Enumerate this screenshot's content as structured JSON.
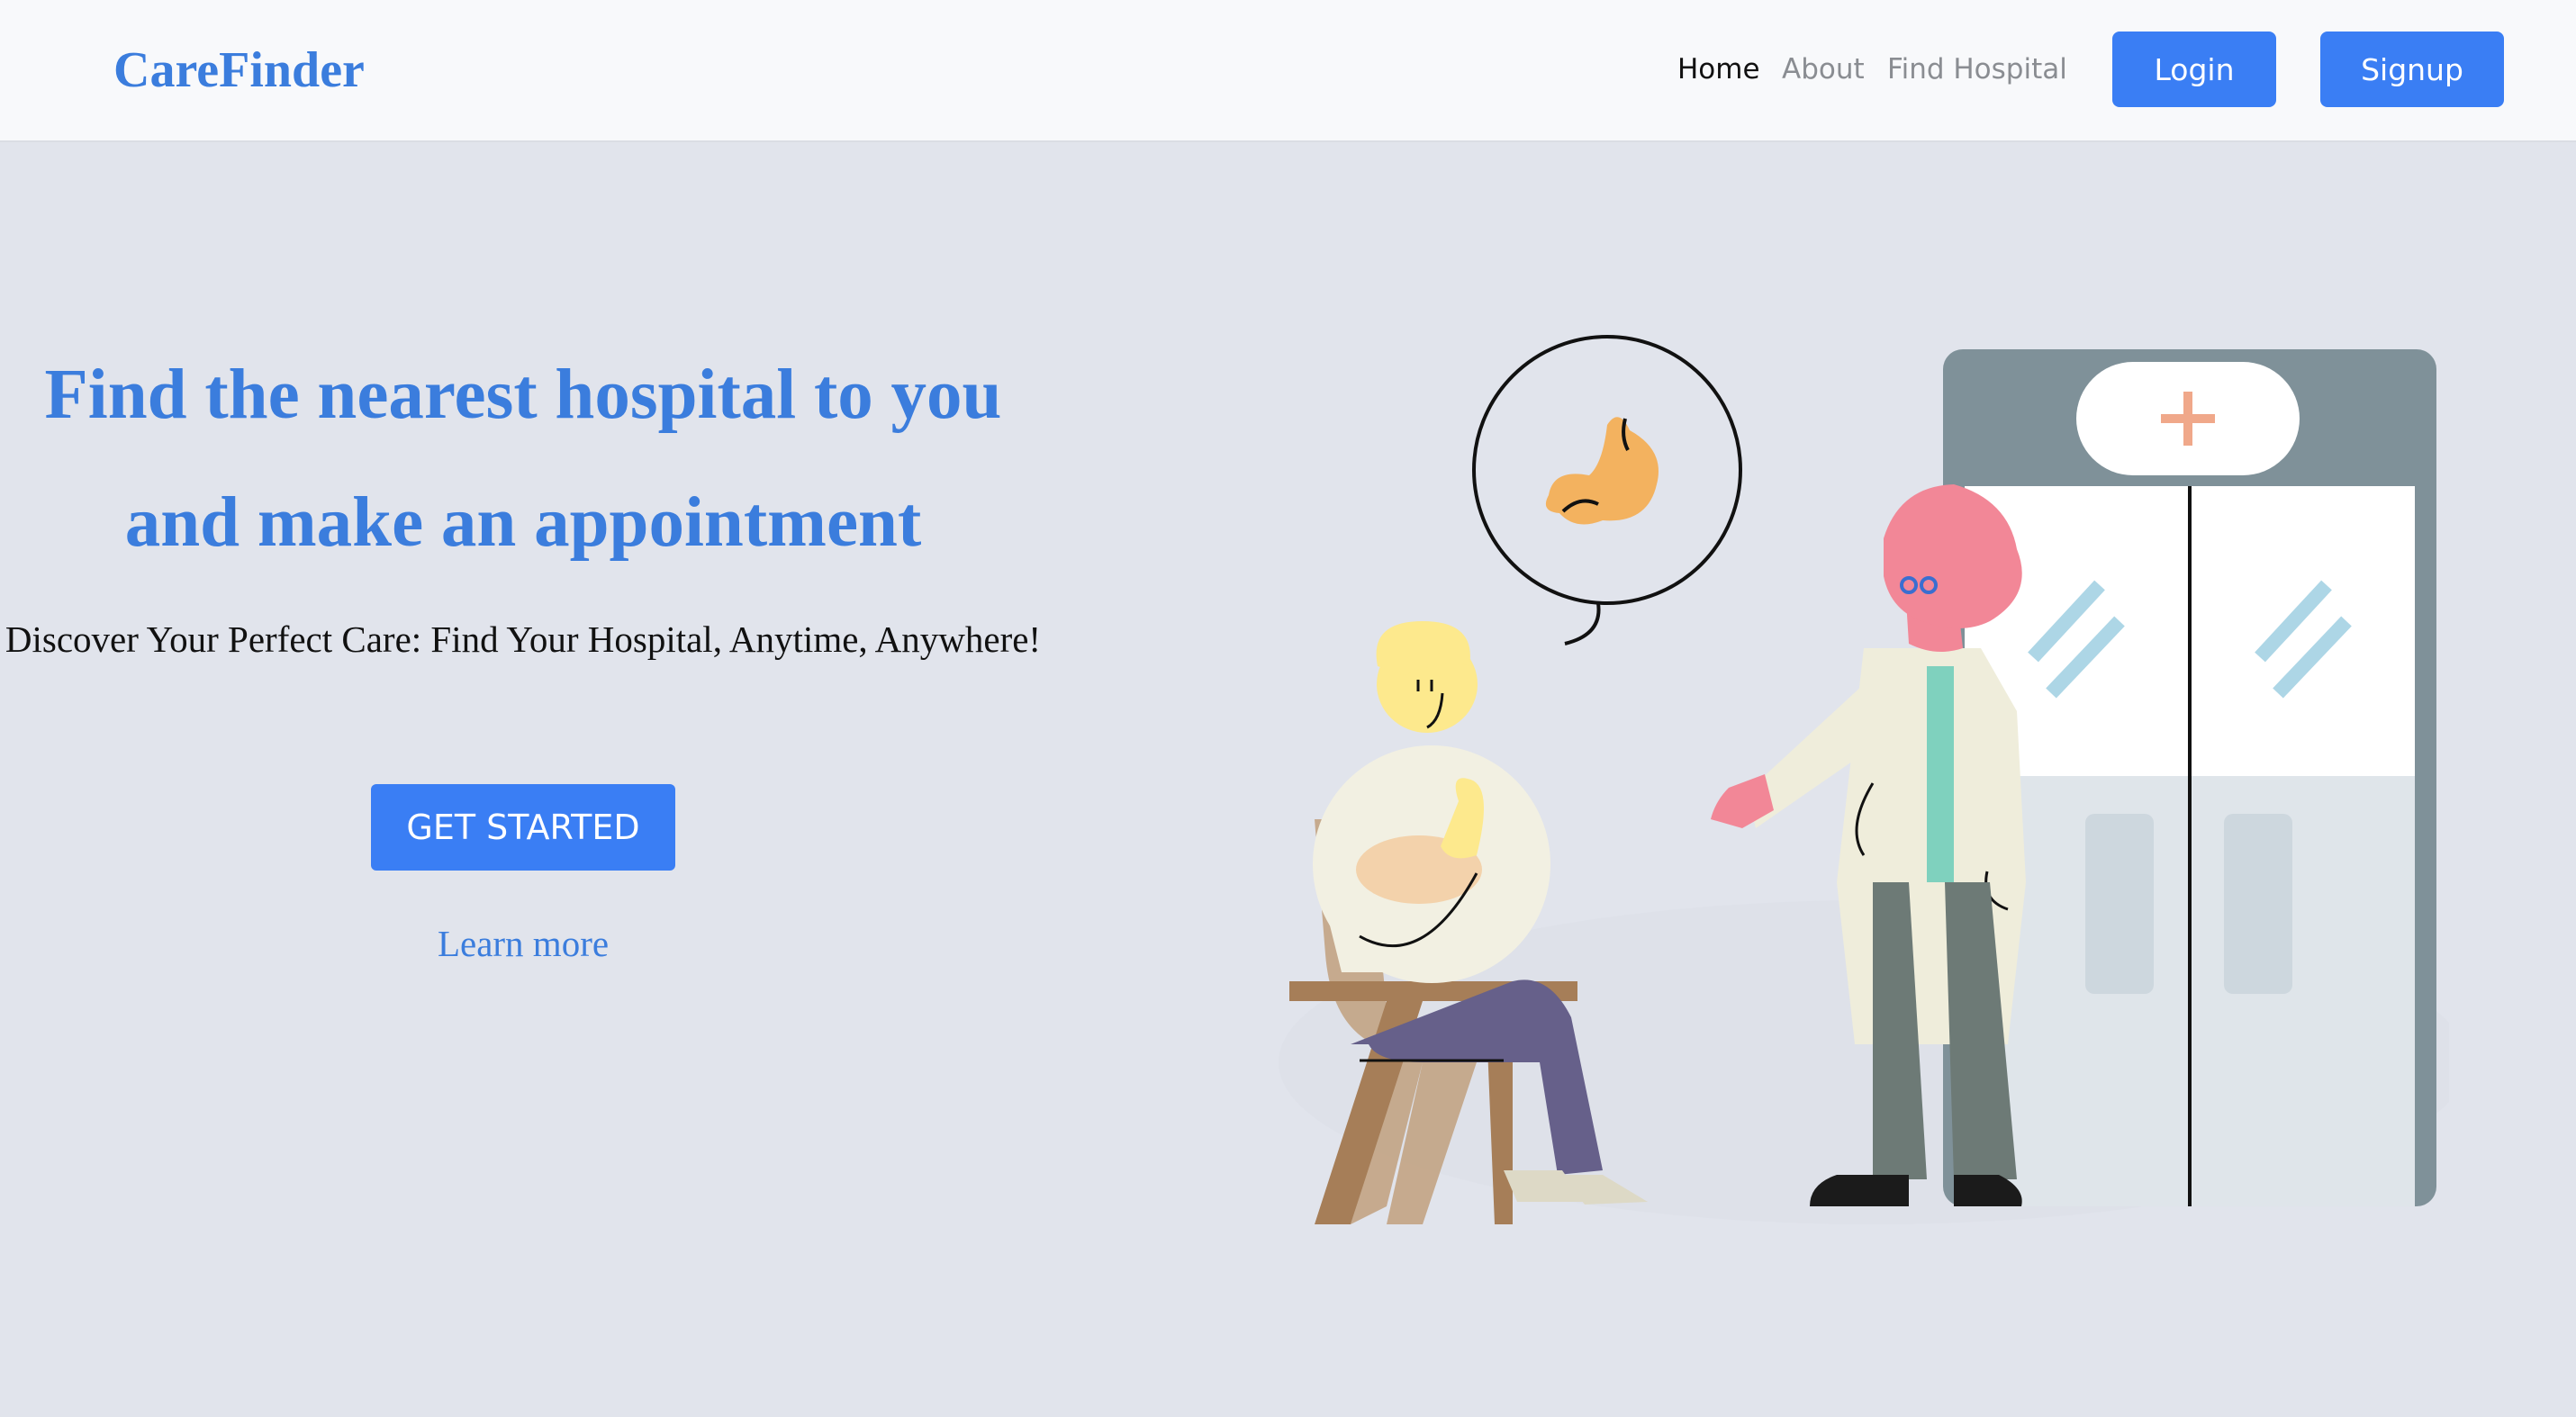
{
  "navbar": {
    "brand": "CareFinder",
    "links": [
      {
        "label": "Home",
        "active": true
      },
      {
        "label": "About",
        "active": false
      },
      {
        "label": "Find Hospital",
        "active": false
      }
    ],
    "login_label": "Login",
    "signup_label": "Signup"
  },
  "hero": {
    "title_line1": "Find the nearest hospital to you",
    "title_line2": "and make an appointment",
    "subtitle": "Discover Your Perfect Care: Find Your Hospital, Anytime, Anywhere!",
    "cta_label": "GET STARTED",
    "learn_more_label": "Learn more"
  },
  "colors": {
    "accent": "#3a7ef4",
    "brand_text": "#3b7ddd",
    "page_bg": "#e1e4ec"
  }
}
